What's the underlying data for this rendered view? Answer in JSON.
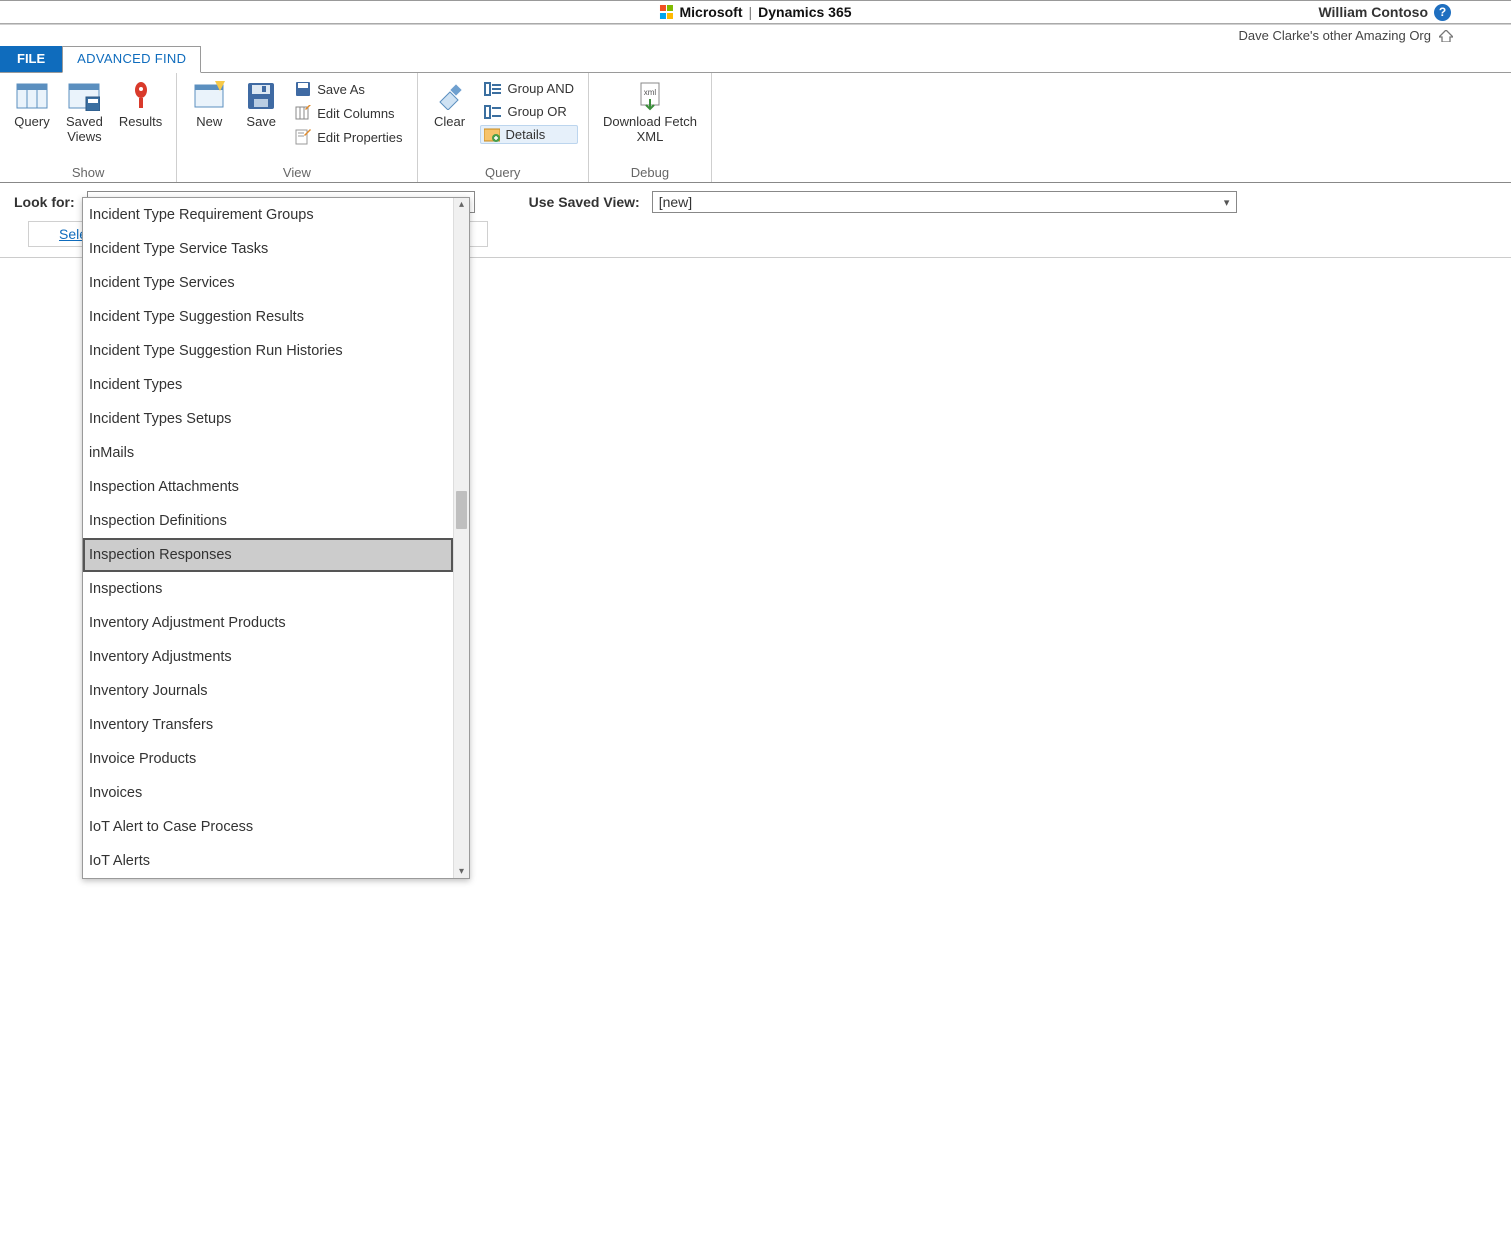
{
  "brand": {
    "microsoft": "Microsoft",
    "product": "Dynamics 365"
  },
  "user": {
    "name": "William Contoso",
    "org": "Dave Clarke's other Amazing Org"
  },
  "tabs": {
    "file": "FILE",
    "advanced_find": "ADVANCED FIND"
  },
  "ribbon": {
    "show": {
      "caption": "Show",
      "query": "Query",
      "saved_views": "Saved\nViews",
      "results": "Results"
    },
    "view": {
      "caption": "View",
      "new": "New",
      "save": "Save",
      "save_as": "Save As",
      "edit_columns": "Edit Columns",
      "edit_properties": "Edit Properties"
    },
    "query": {
      "caption": "Query",
      "clear": "Clear",
      "group_and": "Group AND",
      "group_or": "Group OR",
      "details": "Details"
    },
    "debug": {
      "caption": "Debug",
      "download_fetch_xml": "Download Fetch\nXML"
    }
  },
  "form": {
    "look_for_label": "Look for:",
    "look_for_value": "Inspection Responses",
    "use_saved_view_label": "Use Saved View:",
    "use_saved_view_value": "[new]",
    "select_link": "Sele"
  },
  "dropdown": {
    "items": [
      "Incident Type Requirement Groups",
      "Incident Type Service Tasks",
      "Incident Type Services",
      "Incident Type Suggestion Results",
      "Incident Type Suggestion Run Histories",
      "Incident Types",
      "Incident Types Setups",
      "inMails",
      "Inspection Attachments",
      "Inspection Definitions",
      "Inspection Responses",
      "Inspections",
      "Inventory Adjustment Products",
      "Inventory Adjustments",
      "Inventory Journals",
      "Inventory Transfers",
      "Invoice Products",
      "Invoices",
      "IoT Alert to Case Process",
      "IoT Alerts"
    ],
    "selected_index": 10
  }
}
